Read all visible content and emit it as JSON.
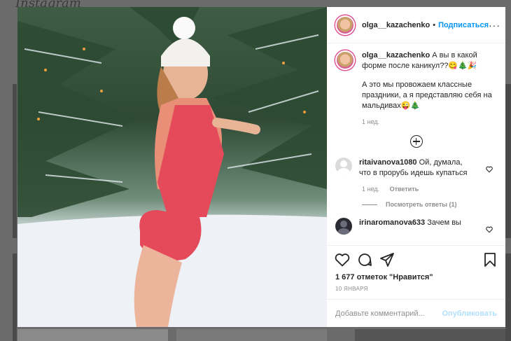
{
  "background": {
    "logo_text": "Instagram"
  },
  "post": {
    "author": {
      "username": "olga__kazachenko",
      "follow_label": "Подписаться"
    },
    "caption": {
      "username": "olga__kazachenko",
      "line1": "А вы в какой форме после каникул??😋🎄🎉",
      "line2": "А это мы провожаем классные праздники, а я представляю себя на мальдивах😜🎄",
      "time": "1 нед."
    },
    "comments": [
      {
        "username": "ritaivanova1080",
        "text": "Ой, думала, что в прорубь идешь купаться",
        "time": "1 нед.",
        "reply_label": "Ответить",
        "view_replies": "Посмотреть ответы (1)"
      },
      {
        "username": "irinaromanova633",
        "text": "Зачем вы"
      }
    ],
    "likes_text": "1 677 отметок \"Нравится\"",
    "date": "10 ЯНВАРЯ",
    "comment_placeholder": "Добавьте комментарий...",
    "post_label": "Опубликовать"
  }
}
